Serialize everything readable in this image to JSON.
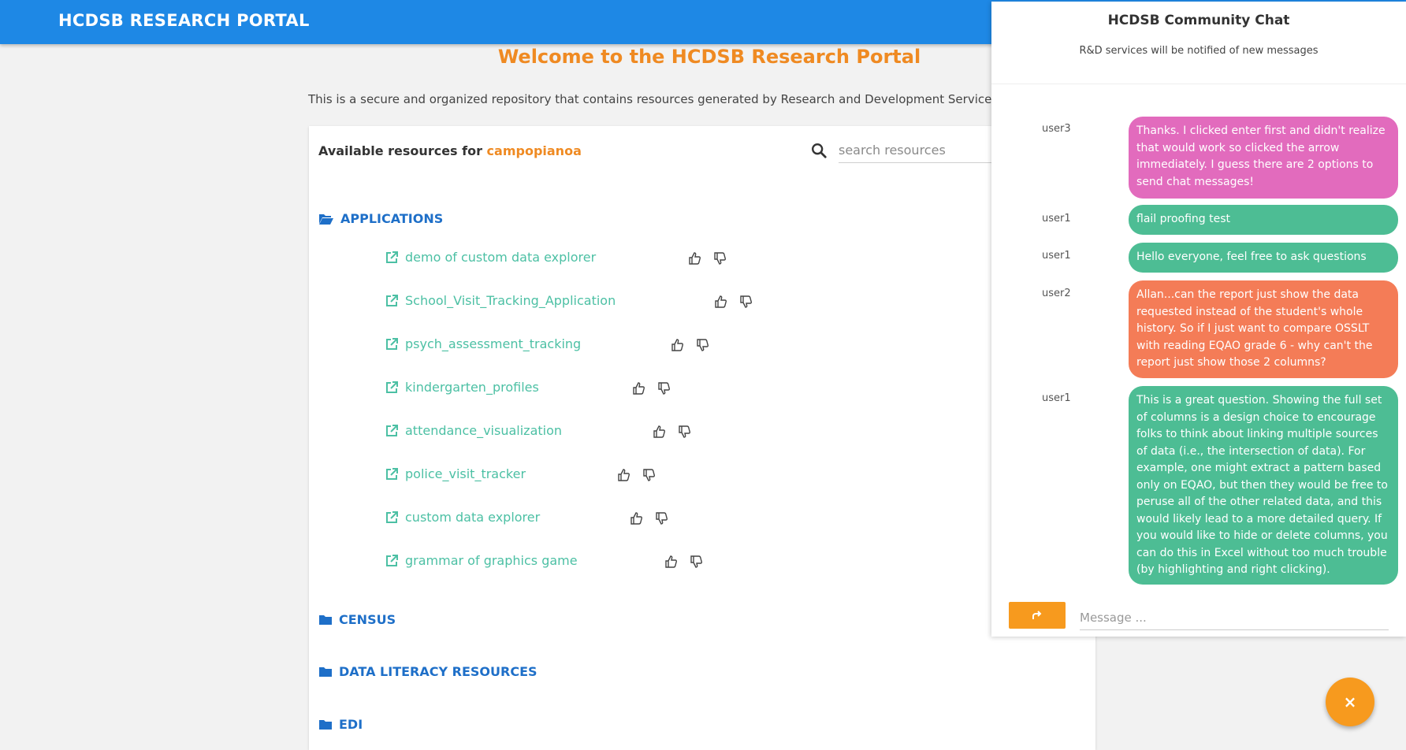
{
  "header": {
    "title": "HCDSB RESEARCH PORTAL"
  },
  "welcome": "Welcome to the HCDSB Research Portal",
  "intro": "This is a secure and organized repository that contains resources generated by Research and Development Services.",
  "resources": {
    "title_prefix": "Available resources for ",
    "username": "campopianoa",
    "search_placeholder": "search resources"
  },
  "folders": {
    "applications": "APPLICATIONS",
    "census": "CENSUS",
    "data_literacy": "DATA LITERACY RESOURCES",
    "edi": "EDI"
  },
  "applications": [
    "demo of custom data explorer",
    "School_Visit_Tracking_Application",
    "psych_assessment_tracking",
    "kindergarten_profiles",
    "attendance_visualization",
    "police_visit_tracker",
    "custom data explorer",
    "grammar of graphics game"
  ],
  "chat": {
    "title": "HCDSB Community Chat",
    "subtitle": "R&D services will be notified of new messages",
    "messages": [
      {
        "user": "user3",
        "text": "Thanks. I clicked enter first and didn't realize that would work so clicked the arrow immediately. I guess there are 2 options to send chat messages!"
      },
      {
        "user": "user1",
        "text": "flail proofing test"
      },
      {
        "user": "user1",
        "text": "Hello everyone, feel free to ask questions"
      },
      {
        "user": "user2",
        "text": "Allan...can the report just show the data requested instead of the student's whole history. So if I just want to compare OSSLT with reading EQAO grade 6 - why can't the report just show those 2 columns?"
      },
      {
        "user": "user1",
        "text": "This is a great question. Showing the full set of columns is a design choice to encourage folks to think about linking multiple sources of data (i.e., the intersection of data). For example, one might extract a pattern based only on EQAO, but then they would be free to peruse all of the other related data, and this would likely lead to a more detailed query. If you would like to hide or delete columns, you can do this in Excel without too much trouble (by highlighting and right clicking)."
      }
    ],
    "message_placeholder": "Message ...",
    "close_label": "×"
  },
  "colors": {
    "primary": "#1e88e5",
    "accent": "#ef8a22",
    "link": "#4cc0a4",
    "folder": "#1e6fc8"
  }
}
